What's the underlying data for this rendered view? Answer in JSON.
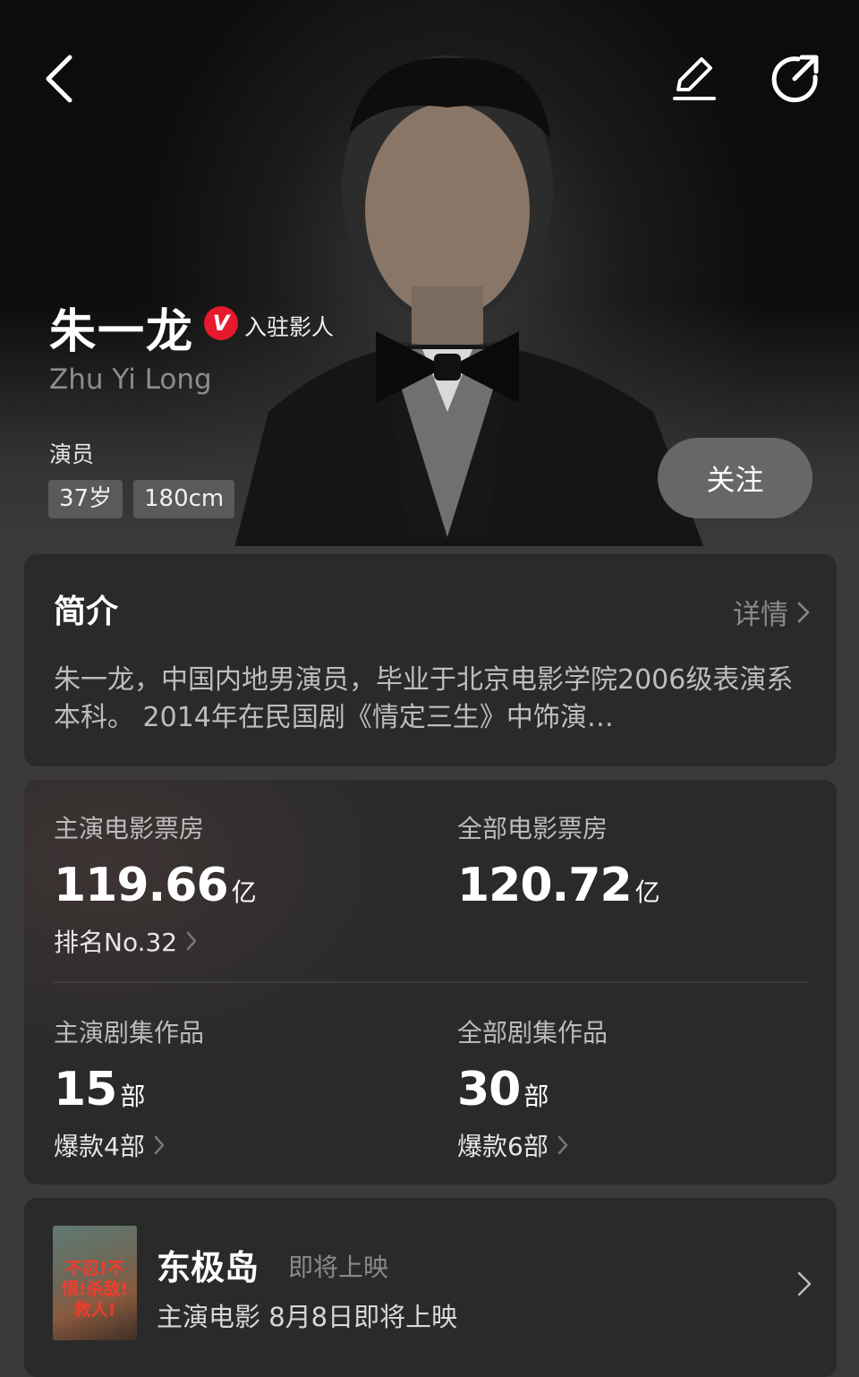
{
  "header": {
    "back_icon": "chevron-left-icon",
    "edit_icon": "pencil-icon",
    "share_icon": "share-icon"
  },
  "profile": {
    "name": "朱一龙",
    "verified_badge": "V",
    "verified_label": "入驻影人",
    "pinyin": "Zhu Yi Long",
    "role": "演员",
    "tags": [
      "37岁",
      "180cm"
    ],
    "follow_label": "关注"
  },
  "intro": {
    "title": "简介",
    "more_label": "详情",
    "text": "朱一龙，中国内地男演员，毕业于北京电影学院2006级表演系本科。 2014年在民国剧《情定三生》中饰演…"
  },
  "stats": [
    {
      "label": "主演电影票房",
      "value": "119.66",
      "unit": "亿",
      "sub": "排名No.32"
    },
    {
      "label": "全部电影票房",
      "value": "120.72",
      "unit": "亿",
      "sub": ""
    },
    {
      "label": "主演剧集作品",
      "value": "15",
      "unit": "部",
      "sub": "爆款4部"
    },
    {
      "label": "全部剧集作品",
      "value": "30",
      "unit": "部",
      "sub": "爆款6部"
    }
  ],
  "film": {
    "title": "东极岛",
    "status": "即将上映",
    "subtitle": "主演电影  8月8日即将上映",
    "poster_text": "不忍!不惧!杀敌!救人!"
  },
  "colors": {
    "background": "#3a3a3a",
    "card": "#2a2a2a",
    "badge_red": "#e6192d",
    "follow_button": "#676767"
  }
}
